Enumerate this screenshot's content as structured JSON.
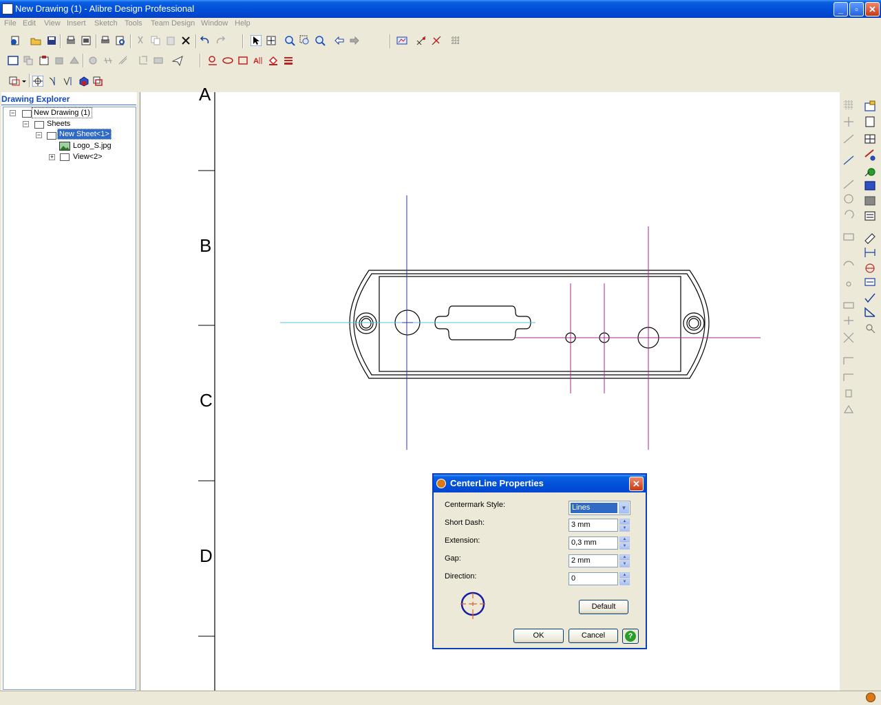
{
  "window": {
    "title": "New Drawing (1) - Alibre Design Professional"
  },
  "menu": [
    "File",
    "Edit",
    "View",
    "Insert",
    "Sketch",
    "Tools",
    "Team Design",
    "Window",
    "Help"
  ],
  "explorer": {
    "title": "Drawing Explorer",
    "items": {
      "drawing": "New Drawing (1)",
      "sheets": "Sheets",
      "sheet": "New Sheet<1>",
      "logo": "Logo_S.jpg",
      "view": "View<2>"
    }
  },
  "sheet_zones": {
    "a": "A",
    "b": "B",
    "c": "C",
    "d": "D"
  },
  "dialog": {
    "title": "CenterLine Properties",
    "centermark_style": {
      "label": "Centermark Style:",
      "value": "Lines"
    },
    "short_dash": {
      "label": "Short Dash:",
      "value": "3 mm"
    },
    "extension": {
      "label": "Extension:",
      "value": "0,3 mm"
    },
    "gap": {
      "label": "Gap:",
      "value": "2 mm"
    },
    "direction": {
      "label": "Direction:",
      "value": "0"
    },
    "default_button": "Default",
    "ok_button": "OK",
    "cancel_button": "Cancel"
  },
  "colors": {
    "titlebar": "#0250d8",
    "centerline_blue": "#3030a0",
    "centerline_cyan": "#4fc0e0",
    "centerline_magenta": "#a02890",
    "selection": "#316ac5"
  }
}
